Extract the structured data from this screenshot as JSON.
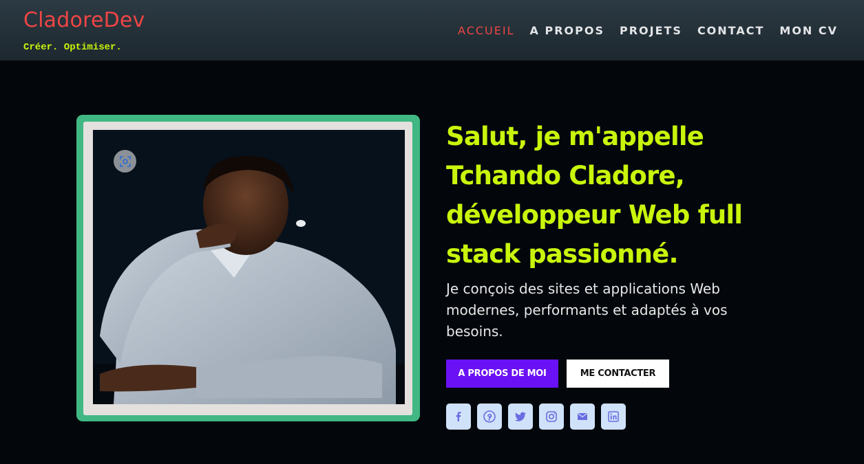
{
  "header": {
    "brand": "CladoreDev",
    "tagline": "Créer. Optimiser.",
    "nav": [
      {
        "label": "ACCUEIL",
        "active": true
      },
      {
        "label": "A PROPOS",
        "active": false
      },
      {
        "label": "PROJETS",
        "active": false
      },
      {
        "label": "CONTACT",
        "active": false
      },
      {
        "label": "MON CV",
        "active": false
      }
    ]
  },
  "hero": {
    "photo_alt": "Portrait",
    "headline": "Salut, je m'appelle Tchando Cladore, développeur Web full stack passionné.",
    "intro": "Je conçois des sites et applications Web modernes, performants et adaptés à vos besoins.",
    "primary_button": "A PROPOS DE MOI",
    "secondary_button": "ME CONTACTER",
    "socials": [
      {
        "icon": "facebook-icon"
      },
      {
        "icon": "pinterest-icon"
      },
      {
        "icon": "twitter-icon"
      },
      {
        "icon": "instagram-icon"
      },
      {
        "icon": "mail-icon"
      },
      {
        "icon": "linkedin-icon"
      }
    ]
  },
  "colors": {
    "accent": "#c8f50b",
    "brand": "#ef4545",
    "primary_button": "#6b11f5",
    "frame": "#41b783",
    "social_bg": "#cfe2fa",
    "social_icon": "#6b6be0"
  }
}
